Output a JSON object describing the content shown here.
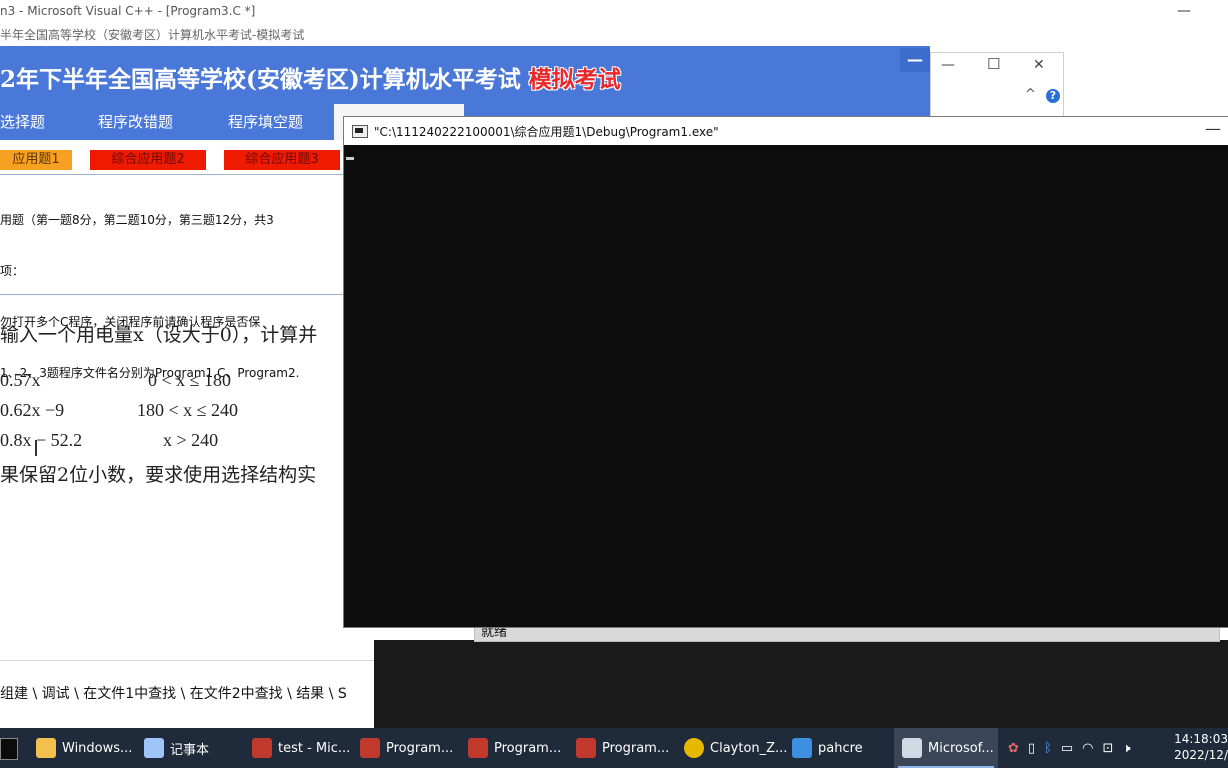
{
  "vc_window": {
    "title": "n3 - Microsoft Visual C++ - [Program3.C *]",
    "minimize": "—",
    "close": "✕"
  },
  "exam_window": {
    "title": "半年全国高等学校（安徽考区）计算机水平考试-模拟考试",
    "banner_text": "2年下半年全国高等学校(安徽考区)计算机水平考试",
    "banner_highlight": "模拟考试",
    "minimize": "—",
    "nav": [
      "选择题",
      "程序改错题",
      "程序填空题"
    ],
    "subtabs": [
      "应用题1",
      "综合应用题2",
      "综合应用题3"
    ],
    "notes": [
      "用题（第一题8分，第二题10分，第三题12分，共3",
      "项：",
      "勿打开多个C程序，关闭程序前请确认程序是否保",
      "1、2、3题程序文件名分别为Program1.C、Program2."
    ],
    "question": "输入一个用电量x（设大于0），计算并",
    "formula_rows": [
      {
        "expr": "0.57x",
        "cond": "0 < x ≤ 180"
      },
      {
        "expr": "0.62x −9",
        "cond": "180 < x ≤ 240"
      },
      {
        "expr": "0.8x − 52.2",
        "cond": "x > 240"
      }
    ],
    "footer_text": "果保留2位小数，要求使用选择结构实"
  },
  "small_window": {
    "minimize": "—",
    "maximize": "☐",
    "close": "✕",
    "chevron": "^",
    "help": "?"
  },
  "output_pane": {
    "tabs": "组建 \\ 调试 \\ 在文件1中查找 \\ 在文件2中查找 \\ 结果 \\ S"
  },
  "status_bar": {
    "text": "就绪"
  },
  "console": {
    "title": "\"C:\\111240222100001\\综合应用题1\\Debug\\Program1.exe\"",
    "minimize": "—"
  },
  "taskbar": {
    "items": [
      {
        "label": "Windows...",
        "icon": "folder-icon",
        "color": "#f2c14e"
      },
      {
        "label": "记事本",
        "icon": "notepad-icon",
        "color": "#9fc5f8"
      },
      {
        "label": "test - Mic...",
        "icon": "vc-icon",
        "color": "#c0392b"
      },
      {
        "label": "Program...",
        "icon": "vc-icon",
        "color": "#c0392b"
      },
      {
        "label": "Program...",
        "icon": "vc-icon",
        "color": "#c0392b"
      },
      {
        "label": "Program...",
        "icon": "vc-icon",
        "color": "#c0392b"
      },
      {
        "label": "Clayton_Z...",
        "icon": "chrome-icon",
        "color": "#e6b800"
      },
      {
        "label": "pahcre",
        "icon": "remote-desktop-icon",
        "color": "#3d8fe0"
      },
      {
        "label": "Microsof...",
        "icon": "window-icon",
        "color": "#cfd8e3"
      }
    ],
    "time": "14:18:03",
    "date": "2022/12/"
  }
}
